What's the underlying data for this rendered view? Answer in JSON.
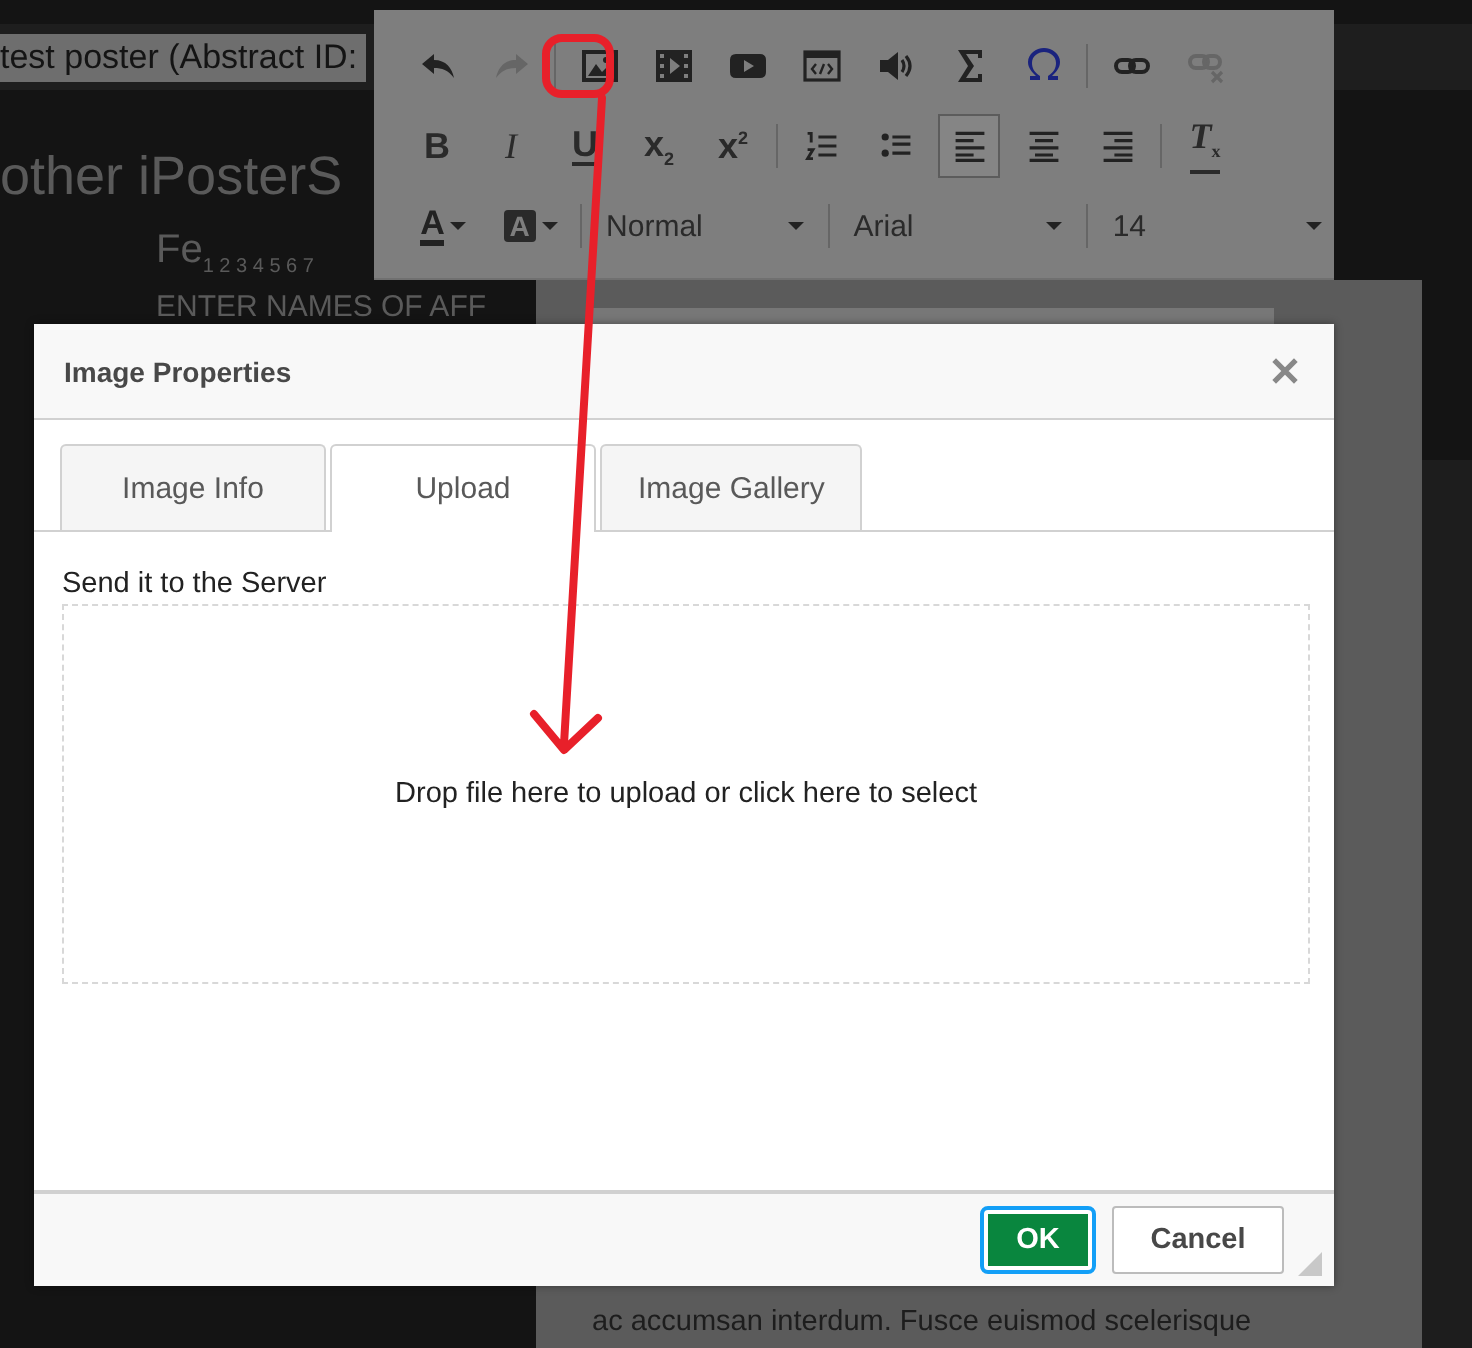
{
  "page": {
    "tab_title": "test poster (Abstract ID:",
    "heading": "other iPosterS",
    "subheading": "Fe",
    "subheading_marks": "1 2 3 4 5 6 7",
    "affiliations": "ENTER NAMES OF AFF",
    "body_lines": [
      "ac accumsan interdum. Fusce euismod scelerisque"
    ]
  },
  "toolbar": {
    "row1": [
      {
        "kind": "undo",
        "disabled": false
      },
      {
        "kind": "redo",
        "disabled": true
      },
      {
        "kind": "sep"
      },
      {
        "kind": "image",
        "disabled": false
      },
      {
        "kind": "film",
        "disabled": false
      },
      {
        "kind": "video",
        "disabled": false
      },
      {
        "kind": "embed",
        "disabled": false
      },
      {
        "kind": "audio",
        "disabled": false
      },
      {
        "kind": "sigma",
        "disabled": false
      },
      {
        "kind": "omega",
        "disabled": false
      },
      {
        "kind": "sep"
      },
      {
        "kind": "link",
        "disabled": false
      },
      {
        "kind": "unlink",
        "disabled": true
      }
    ],
    "row2": [
      {
        "kind": "bold",
        "label": "B",
        "selected": false
      },
      {
        "kind": "italic",
        "label": "I",
        "selected": false
      },
      {
        "kind": "underline",
        "label": "U",
        "selected": false
      },
      {
        "kind": "sub",
        "label": "x",
        "index": "2",
        "selected": false
      },
      {
        "kind": "sup",
        "label": "x",
        "index": "2",
        "selected": false
      },
      {
        "kind": "sep"
      },
      {
        "kind": "ol",
        "selected": false
      },
      {
        "kind": "ul",
        "selected": false
      },
      {
        "kind": "left",
        "selected": true
      },
      {
        "kind": "center",
        "selected": false
      },
      {
        "kind": "right",
        "selected": false
      },
      {
        "kind": "sep"
      },
      {
        "kind": "clear",
        "label": "T",
        "index": "x",
        "selected": false
      }
    ],
    "text_color": "A",
    "bg_color": "A",
    "dropdowns": [
      "Normal",
      "Arial",
      "14"
    ]
  },
  "dialog": {
    "title": "Image Properties",
    "tabs": [
      {
        "label": "Image Info",
        "selected": false
      },
      {
        "label": "Upload",
        "selected": true
      },
      {
        "label": "Image Gallery",
        "selected": false
      }
    ],
    "section_label": "Send it to the Server",
    "dropzone": "Drop file here to upload or click here to select",
    "buttons": [
      {
        "label": "OK",
        "kind": "primary"
      },
      {
        "label": "Cancel",
        "kind": "secondary"
      }
    ]
  }
}
